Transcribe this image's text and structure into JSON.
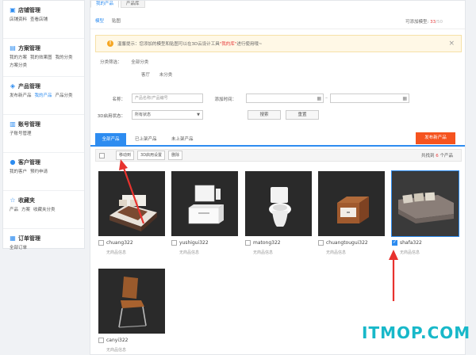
{
  "sidebar": {
    "groups": [
      {
        "title": "店铺管理",
        "icon": "store-icon",
        "links": [
          "店铺资料",
          "查看店铺"
        ],
        "active": -1
      },
      {
        "title": "方案管理",
        "icon": "document-icon",
        "links": [
          "我的方案",
          "我的效果图",
          "我的分类",
          "方案分类"
        ],
        "active": -1
      },
      {
        "title": "产品管理",
        "icon": "cube-icon",
        "links": [
          "发布新产品",
          "我的产品",
          "产品分类"
        ],
        "active": 1
      },
      {
        "title": "账号管理",
        "icon": "account-icon",
        "links": [
          "子账号管理"
        ],
        "active": -1
      },
      {
        "title": "客户管理",
        "icon": "user-icon",
        "links": [
          "我的客户",
          "预约申请"
        ],
        "active": -1
      },
      {
        "title": "收藏夹",
        "icon": "star-icon",
        "links": [
          "产品",
          "方案",
          "收藏夹分类"
        ],
        "active": -1
      },
      {
        "title": "订单管理",
        "icon": "order-icon",
        "links": [
          "全部订单"
        ],
        "active": -1
      }
    ]
  },
  "main": {
    "top_tabs": [
      "我的产品",
      "产品库"
    ],
    "sub_tabs": [
      "模型",
      "贴图"
    ],
    "quota": {
      "label": "可添加模型:",
      "used": "33",
      "max": "/50"
    },
    "notice": {
      "text_before": "温馨提示：您添加的模型和贴图可以在3D云设计工具",
      "highlight": "\"我的库\"",
      "text_after": "进行使用哦~"
    },
    "category": {
      "label": "分类筛选：",
      "options": [
        "全部分类",
        "客厅",
        "未分类"
      ]
    },
    "filters": {
      "name_label": "名称：",
      "name_placeholder": "产品名称/产品编号",
      "time_label": "添加时间：",
      "status_label": "3D启用状态：",
      "status_value": "所有状态",
      "search_button": "搜索",
      "reset_button": "重置"
    },
    "status_tabs": [
      "全部产品",
      "已上架产品",
      "未上架产品"
    ],
    "publish_button": "发布新产品",
    "toolbar": {
      "move": "移动到",
      "settings": "3D启用设置",
      "delete": "删除"
    },
    "total": {
      "prefix": "共找到",
      "count": "6",
      "suffix": "个产品"
    },
    "products": [
      {
        "name": "chuang322",
        "sub": "无商品信息",
        "checked": false
      },
      {
        "name": "yushigui322",
        "sub": "无商品信息",
        "checked": false
      },
      {
        "name": "matong322",
        "sub": "无商品信息",
        "checked": false
      },
      {
        "name": "chuangtougui322",
        "sub": "无商品信息",
        "checked": false
      },
      {
        "name": "shafa322",
        "sub": "无商品信息",
        "checked": true
      },
      {
        "name": "canyi322",
        "sub": "无商品信息",
        "checked": false
      }
    ]
  },
  "watermark": "ITMOP.COM",
  "colors": {
    "accent": "#2d8cf0",
    "publish": "#f5531f",
    "highlight": "#e63c3c",
    "annotation_arrow": "#e8322e"
  }
}
